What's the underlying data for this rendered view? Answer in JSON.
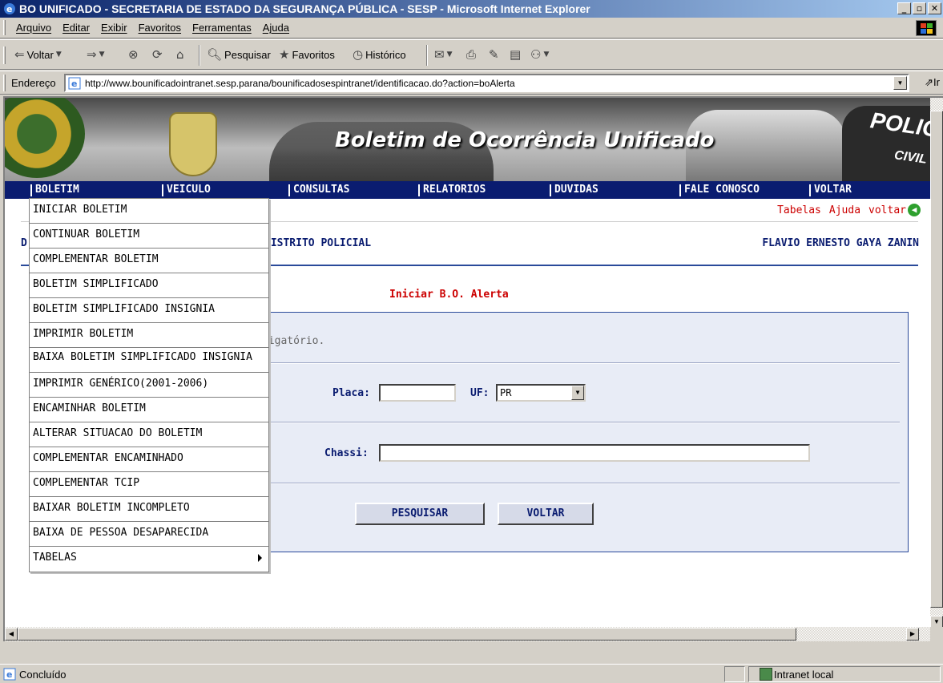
{
  "window": {
    "title": "BO UNIFICADO - SECRETARIA DE ESTADO DA SEGURANÇA PÚBLICA - SESP - Microsoft Internet Explorer"
  },
  "menubar": {
    "items": [
      "Arquivo",
      "Editar",
      "Exibir",
      "Favoritos",
      "Ferramentas",
      "Ajuda"
    ]
  },
  "toolbar": {
    "back_label": "Voltar",
    "search_label": "Pesquisar",
    "favorites_label": "Favoritos",
    "history_label": "Histórico"
  },
  "address": {
    "label": "Endereço",
    "url": "http://www.bounificadointranet.sesp.parana/bounificadosespintranet/identificacao.do?action=boAlerta",
    "go_label": "Ir"
  },
  "banner": {
    "title": "Boletim de Ocorrência Unificado",
    "badge_right_top": "POLICIA",
    "badge_right_bottom": "CIVIL"
  },
  "nav": {
    "items": [
      "BOLETIM",
      "VEICULO",
      "CONSULTAS",
      "RELATORIOS",
      "DUVIDAS",
      "FALE CONOSCO",
      "VOLTAR"
    ]
  },
  "toplinks": {
    "tabelas": "Tabelas",
    "ajuda": "Ajuda",
    "voltar": "voltar"
  },
  "header": {
    "left_initial": "D",
    "district": "DISTRITO POLICIAL",
    "user": "FLAVIO ERNESTO GAYA ZANIN"
  },
  "page": {
    "heading": "Iniciar B.O. Alerta",
    "required_note": "rigatório."
  },
  "form": {
    "placa_label": "Placa:",
    "placa_value": "",
    "uf_label": "UF:",
    "uf_value": "PR",
    "chassi_label": "Chassi:",
    "chassi_value": "",
    "search_button": "PESQUISAR",
    "back_button": "VOLTAR"
  },
  "dropdown": {
    "items": [
      "INICIAR BOLETIM",
      "CONTINUAR BOLETIM",
      "COMPLEMENTAR BOLETIM",
      "BOLETIM SIMPLIFICADO",
      "BOLETIM SIMPLIFICADO INSIGNIA",
      "IMPRIMIR BOLETIM",
      "BAIXA BOLETIM SIMPLIFICADO INSIGNIA",
      "IMPRIMIR GENÉRICO(2001-2006)",
      "ENCAMINHAR BOLETIM",
      "ALTERAR SITUACAO DO BOLETIM",
      "COMPLEMENTAR ENCAMINHADO",
      "COMPLEMENTAR TCIP",
      "BAIXAR BOLETIM INCOMPLETO",
      "BAIXA DE PESSOA DESAPARECIDA",
      "TABELAS"
    ]
  },
  "statusbar": {
    "status": "Concluído",
    "zone": "Intranet local"
  },
  "colors": {
    "nav_bg": "#0a1c70",
    "heading_red": "#cc0000",
    "title_gradient_start": "#0a246a"
  }
}
